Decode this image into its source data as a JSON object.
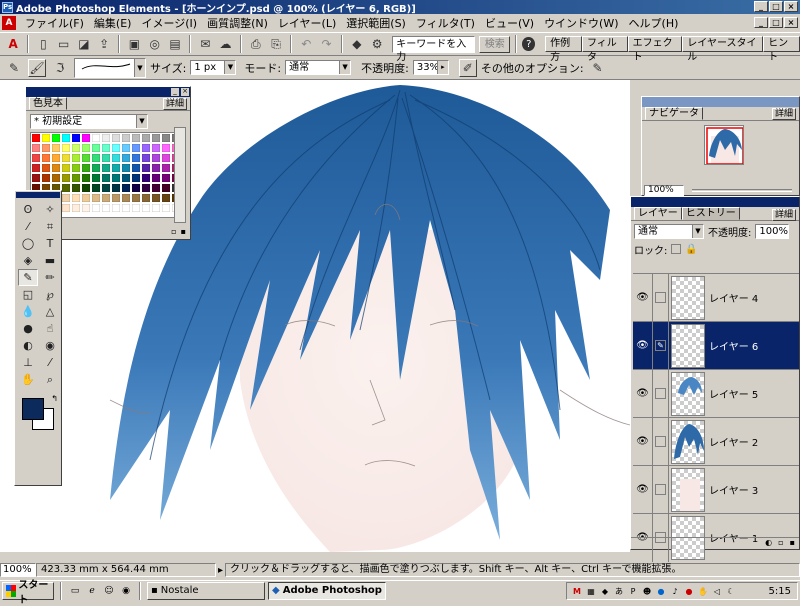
{
  "title_bar": {
    "text": "Adobe Photoshop Elements - [ホーンインプ.psd @ 100% (レイヤー 6, RGB)]",
    "buttons": [
      "_",
      "□",
      "×"
    ]
  },
  "menu_bar": {
    "items": [
      "ファイル(F)",
      "編集(E)",
      "イメージ(I)",
      "画質調整(N)",
      "レイヤー(L)",
      "選択範囲(S)",
      "フィルタ(T)",
      "ビュー(V)",
      "ウインドウ(W)",
      "ヘルプ(H)"
    ],
    "doc_buttons": [
      "_",
      "□",
      "×"
    ]
  },
  "toolbar": {
    "search_placeholder": "キーワードを入力",
    "search_button": "検索",
    "help_icon": "?",
    "palette_well_tabs": [
      "作例方",
      "フィルタ",
      "エフェクト",
      "レイヤースタイル",
      "ヒント"
    ]
  },
  "options_bar": {
    "size_label": "サイズ:",
    "size_value": "1 px",
    "mode_label": "モード:",
    "mode_value": "通常",
    "opacity_label": "不透明度:",
    "opacity_value": "33%",
    "other_options_label": "その他のオプション:"
  },
  "swatches_palette": {
    "tab_label": "色見本",
    "more_label": "詳細",
    "preset_value": "* 初期設定",
    "colors": [
      "#ff0000",
      "#ffff00",
      "#00ff00",
      "#00ffff",
      "#0000ff",
      "#ff00ff",
      "#ffffff",
      "#eeeeee",
      "#dddddd",
      "#cccccc",
      "#bbbbbb",
      "#aaaaaa",
      "#999999",
      "#888888",
      "#777777",
      "#ff8080",
      "#ff9966",
      "#ffcc66",
      "#ffff66",
      "#ccff66",
      "#99ff66",
      "#66ff99",
      "#66ffcc",
      "#66ffff",
      "#66ccff",
      "#6699ff",
      "#9966ff",
      "#cc66ff",
      "#ff66ff",
      "#ff66cc",
      "#ee4444",
      "#ff7733",
      "#ffaa33",
      "#eedd33",
      "#aaee33",
      "#55dd33",
      "#33dd77",
      "#33ddaa",
      "#33dddd",
      "#33aadd",
      "#3377dd",
      "#7744dd",
      "#aa44dd",
      "#dd44dd",
      "#dd4499",
      "#cc2222",
      "#dd5511",
      "#dd8811",
      "#cccc11",
      "#88cc11",
      "#33aa11",
      "#11aa55",
      "#11aa88",
      "#11aaaa",
      "#1188aa",
      "#1155aa",
      "#5522aa",
      "#8822aa",
      "#aa22aa",
      "#aa2266",
      "#991111",
      "#aa3300",
      "#aa6600",
      "#999900",
      "#669900",
      "#227700",
      "#007733",
      "#007766",
      "#007777",
      "#005577",
      "#003377",
      "#330077",
      "#660077",
      "#770077",
      "#770044",
      "#661100",
      "#774400",
      "#665500",
      "#556600",
      "#335500",
      "#114400",
      "#004422",
      "#004444",
      "#003344",
      "#002255",
      "#110044",
      "#330044",
      "#440033",
      "#440022",
      "#333333",
      "#c8a07a",
      "#d8b088",
      "#e8c098",
      "#f0d0a8",
      "#ffe0b8",
      "#eecc99",
      "#ddbb88",
      "#ccaa77",
      "#bb9966",
      "#aa8855",
      "#997744",
      "#886633",
      "#775522",
      "#664411",
      "#553300",
      "#f4c8a0",
      "#f8d4b0",
      "#fcdcc0",
      "#ffe4cc",
      "#ffeedd",
      "#fff4ea",
      "#ffffff",
      "#ffffff",
      "#ffffff",
      "#ffffff",
      "#ffffff",
      "#ffffff",
      "#ffffff",
      "#ffffff",
      "#ffffff"
    ]
  },
  "navigator": {
    "tab_label": "ナビゲータ",
    "more_label": "詳細",
    "zoom_value": "100%"
  },
  "layers_palette": {
    "tabs": [
      "レイヤー",
      "ヒストリー"
    ],
    "more_label": "詳細",
    "blend_mode": "通常",
    "opacity_label": "不透明度:",
    "opacity_value": "100%",
    "lock_label": "ロック:",
    "layers": [
      {
        "name": "レイヤー 4",
        "visible": true,
        "selected": false,
        "content": "empty"
      },
      {
        "name": "レイヤー 6",
        "visible": true,
        "selected": true,
        "content": "empty"
      },
      {
        "name": "レイヤー 5",
        "visible": true,
        "selected": false,
        "content": "hair-top"
      },
      {
        "name": "レイヤー 2",
        "visible": true,
        "selected": false,
        "content": "hair-full"
      },
      {
        "name": "レイヤー 3",
        "visible": true,
        "selected": false,
        "content": "skin"
      },
      {
        "name": "レイヤー 1",
        "visible": true,
        "selected": false,
        "content": "empty"
      }
    ]
  },
  "status_bar": {
    "zoom": "100%",
    "dimensions": "423.33 mm x 564.44 mm",
    "hint": "クリック＆ドラッグすると、描画色で塗りつぶします。Shift キー、Alt キー、Ctrl キーで機能拡張。"
  },
  "colors": {
    "foreground": "#0d2a5c",
    "background": "#ffffff",
    "hair_blue": "#2e6aa8",
    "title_bar": "#0a246a"
  },
  "taskbar": {
    "start_label": "スタート",
    "tasks": [
      {
        "label": "Nostale",
        "active": false
      },
      {
        "label": "Adobe Photoshop El...",
        "active": true
      }
    ],
    "clock": "5:15"
  }
}
